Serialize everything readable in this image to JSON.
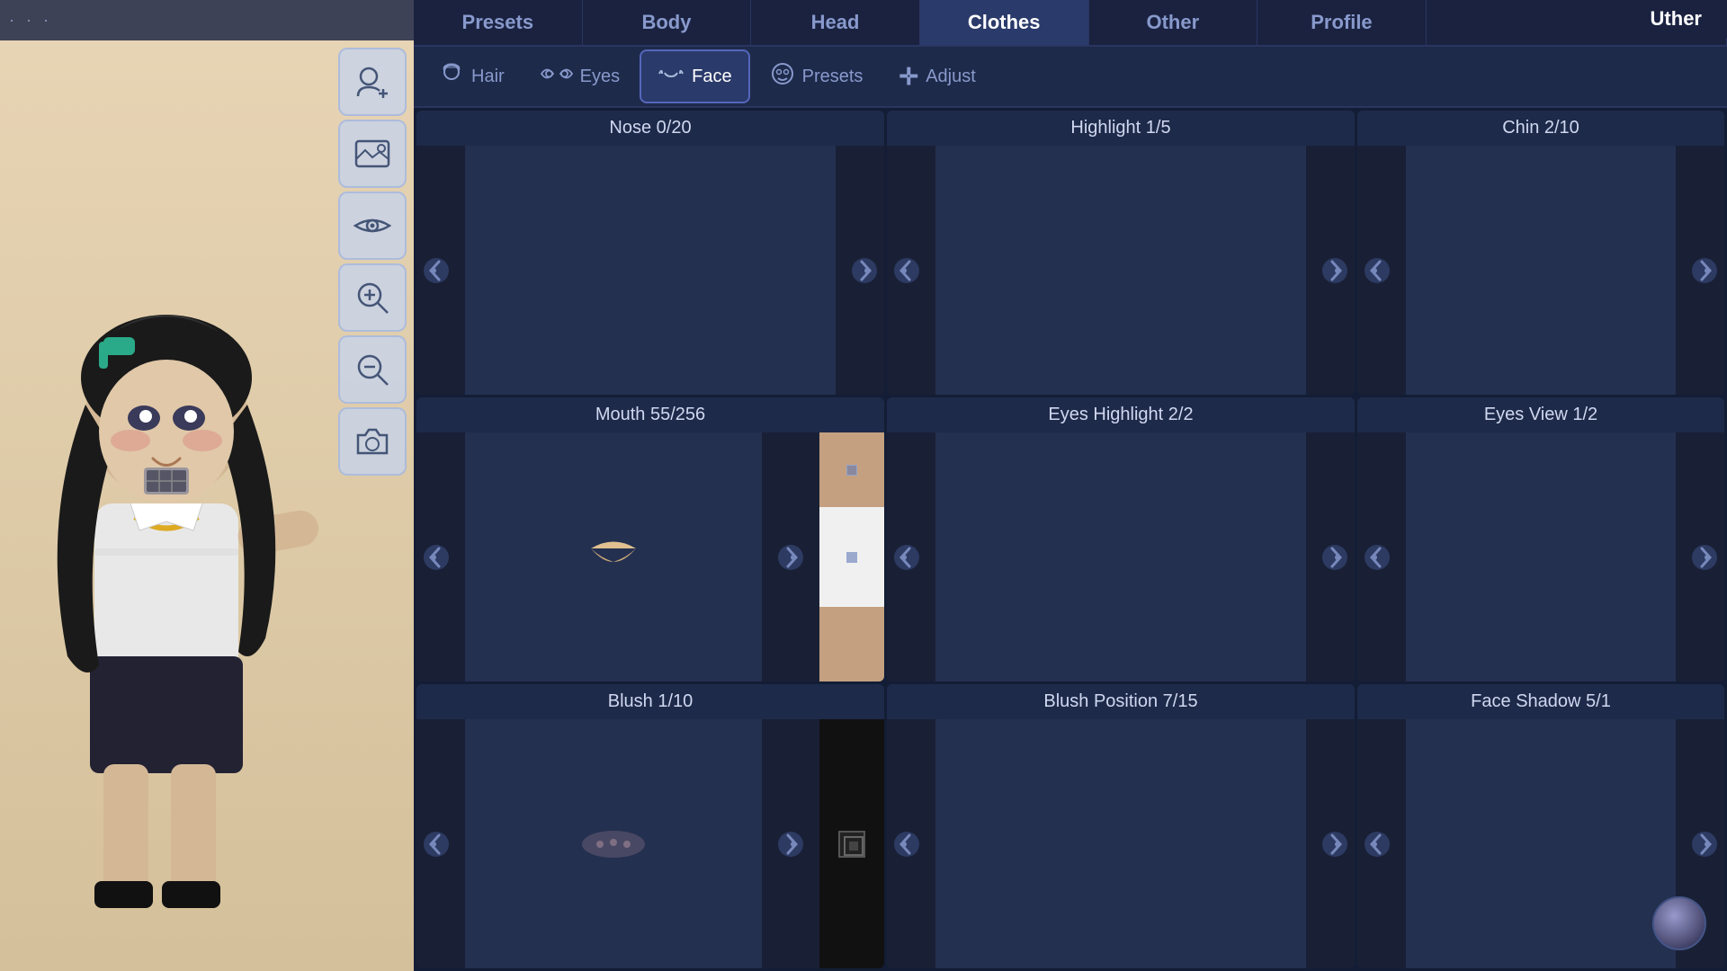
{
  "topbar": {
    "dots": "· · ·"
  },
  "username": "Uther",
  "nav_tabs": [
    {
      "id": "presets",
      "label": "Presets",
      "active": false
    },
    {
      "id": "body",
      "label": "Body",
      "active": false
    },
    {
      "id": "head",
      "label": "Head",
      "active": false
    },
    {
      "id": "clothes",
      "label": "Clothes",
      "active": true
    },
    {
      "id": "other",
      "label": "Other",
      "active": false
    },
    {
      "id": "profile",
      "label": "Profile",
      "active": false
    }
  ],
  "sub_tabs": [
    {
      "id": "hair",
      "label": "Hair",
      "icon": "🧑",
      "active": false
    },
    {
      "id": "eyes",
      "label": "Eyes",
      "icon": "👁",
      "active": false
    },
    {
      "id": "face",
      "label": "Face",
      "icon": "😶",
      "active": true
    },
    {
      "id": "presets",
      "label": "Presets",
      "icon": "🙂",
      "active": false
    },
    {
      "id": "adjust",
      "label": "Adjust",
      "icon": "+",
      "active": false
    }
  ],
  "cells": [
    {
      "id": "nose",
      "title": "Nose 0/20",
      "has_swatch": false,
      "preview_type": "empty"
    },
    {
      "id": "highlight",
      "title": "Highlight 1/5",
      "preview_type": "empty"
    },
    {
      "id": "chin",
      "title": "Chin 2/10",
      "preview_type": "empty"
    },
    {
      "id": "mouth",
      "title": "Mouth 55/256",
      "has_swatch": true,
      "preview_type": "mouth"
    },
    {
      "id": "eyes_highlight",
      "title": "Eyes Highlight 2/2",
      "preview_type": "empty"
    },
    {
      "id": "eyes_view",
      "title": "Eyes View 1/2",
      "preview_type": "empty"
    },
    {
      "id": "blush",
      "title": "Blush 1/10",
      "has_swatch": true,
      "swatch_type": "dark",
      "preview_type": "blush"
    },
    {
      "id": "blush_position",
      "title": "Blush Position 7/15",
      "preview_type": "empty"
    },
    {
      "id": "face_shadow",
      "title": "Face Shadow 5/1",
      "preview_type": "empty"
    }
  ],
  "toolbar_buttons": [
    {
      "id": "add-character",
      "icon": "👤+",
      "unicode": "⊕"
    },
    {
      "id": "gallery",
      "icon": "🖼",
      "unicode": "🖼"
    },
    {
      "id": "eye-view",
      "icon": "👁",
      "unicode": "👁"
    },
    {
      "id": "zoom-in",
      "icon": "🔍+",
      "unicode": "⊕"
    },
    {
      "id": "zoom-out",
      "icon": "🔍-",
      "unicode": "⊖"
    },
    {
      "id": "camera",
      "icon": "📷",
      "unicode": "📷"
    }
  ]
}
